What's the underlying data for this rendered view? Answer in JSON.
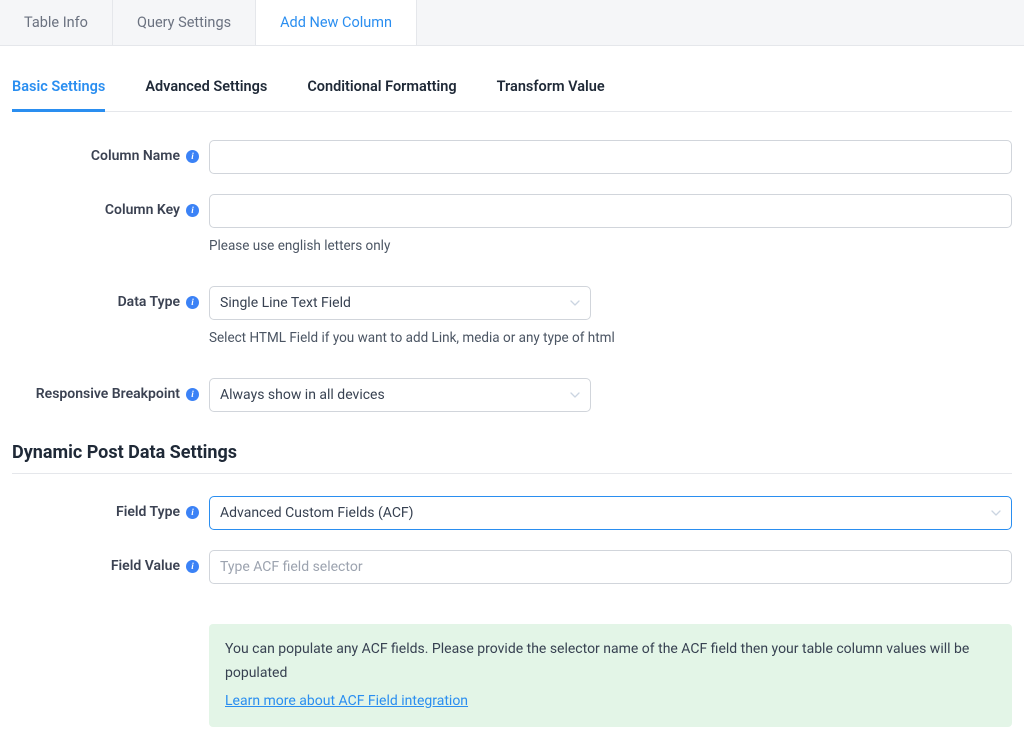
{
  "topTabs": {
    "tableInfo": "Table Info",
    "querySettings": "Query Settings",
    "addNewColumn": "Add New Column"
  },
  "subTabs": {
    "basicSettings": "Basic Settings",
    "advancedSettings": "Advanced Settings",
    "conditionalFormatting": "Conditional Formatting",
    "transformValue": "Transform Value"
  },
  "labels": {
    "columnName": "Column Name",
    "columnKey": "Column Key",
    "dataType": "Data Type",
    "responsiveBreakpoint": "Responsive Breakpoint",
    "fieldType": "Field Type",
    "fieldValue": "Field Value"
  },
  "helpText": {
    "columnKey": "Please use english letters only",
    "dataType": "Select HTML Field if you want to add Link, media or any type of html"
  },
  "values": {
    "dataType": "Single Line Text Field",
    "responsiveBreakpoint": "Always show in all devices",
    "fieldType": "Advanced Custom Fields (ACF)"
  },
  "placeholders": {
    "fieldValue": "Type ACF field selector"
  },
  "sectionHeading": "Dynamic Post Data Settings",
  "notice": {
    "text": "You can populate any ACF fields. Please provide the selector name of the ACF field then your table column values will be populated",
    "link": "Learn more about ACF Field integration"
  },
  "infoGlyph": "i"
}
